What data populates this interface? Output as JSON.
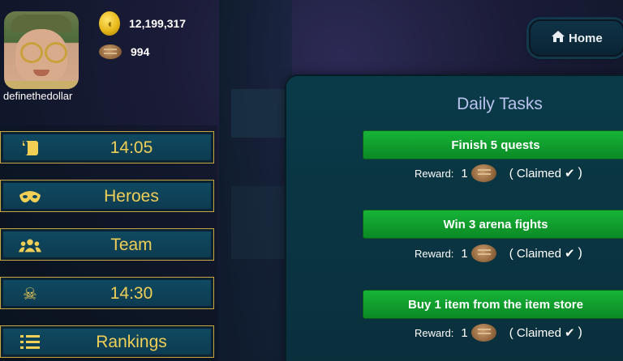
{
  "profile": {
    "username": "definethedollar",
    "gold": "12,199,317",
    "bread": "994"
  },
  "menu": [
    {
      "icon": "scroll-icon",
      "label": "14:05"
    },
    {
      "icon": "mask-icon",
      "label": "Heroes"
    },
    {
      "icon": "users-icon",
      "label": "Team"
    },
    {
      "icon": "skull-crossbones-icon",
      "label": "14:30"
    },
    {
      "icon": "list-icon",
      "label": "Rankings"
    }
  ],
  "home": {
    "label": "Home"
  },
  "daily_tasks": {
    "title": "Daily Tasks",
    "tasks": [
      {
        "name": "Finish 5 quests",
        "reward_label": "Reward:",
        "reward_count": "1",
        "status": "( Claimed",
        "status_end": ")"
      },
      {
        "name": "Win 3 arena fights",
        "reward_label": "Reward:",
        "reward_count": "1",
        "status": "( Claimed",
        "status_end": ")"
      },
      {
        "name": "Buy 1 item from the item store",
        "reward_label": "Reward:",
        "reward_count": "1",
        "status": "( Claimed",
        "status_end": ")"
      }
    ]
  },
  "colors": {
    "menu_text": "#f1cf55",
    "task_button": "#17b337",
    "panel": "#0a3a48",
    "title": "#b9c3ee"
  }
}
